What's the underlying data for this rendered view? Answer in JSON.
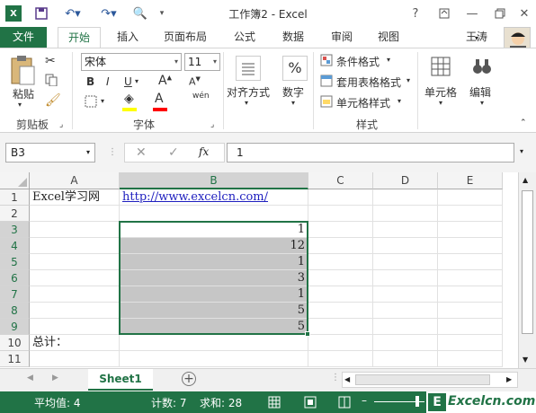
{
  "title": "工作簿2 - Excel",
  "window": {
    "help": "?",
    "minimize": "—",
    "close": "✕"
  },
  "tabs": {
    "file": "文件",
    "home": "开始",
    "insert": "插入",
    "layout": "页面布局",
    "formulas": "公式",
    "data": "数据",
    "review": "审阅",
    "view": "视图",
    "user": "王涛"
  },
  "ribbon": {
    "paste": "粘贴",
    "clipboard": "剪贴板",
    "font_name": "宋体",
    "font_size": "11",
    "bold": "B",
    "italic": "I",
    "underline": "U",
    "font_group": "字体",
    "align": "对齐方式",
    "number": "数字",
    "cond_format": "条件格式",
    "table_format": "套用表格格式",
    "cell_style": "单元格样式",
    "styles_group": "样式",
    "cells": "单元格",
    "editing": "编辑",
    "wen": "wén",
    "percent": "%"
  },
  "formula_bar": {
    "name_box": "B3",
    "fx": "fx",
    "value": "1"
  },
  "columns": [
    "A",
    "B",
    "C",
    "D",
    "E"
  ],
  "rows": [
    "1",
    "2",
    "3",
    "4",
    "5",
    "6",
    "7",
    "8",
    "9",
    "10",
    "11"
  ],
  "cells": {
    "A1": "Excel学习网",
    "B1": "http://www.excelcn.com/",
    "B3": "1",
    "B4": "12",
    "B5": "1",
    "B6": "3",
    "B7": "1",
    "B8": "5",
    "B9": "5",
    "A10": "总计："
  },
  "sheet_tab": "Sheet1",
  "status": {
    "average": "平均值: 4",
    "count": "计数: 7",
    "sum": "求和: 28",
    "watermark": "Excelcn.com"
  },
  "colors": {
    "accent": "#217346"
  }
}
